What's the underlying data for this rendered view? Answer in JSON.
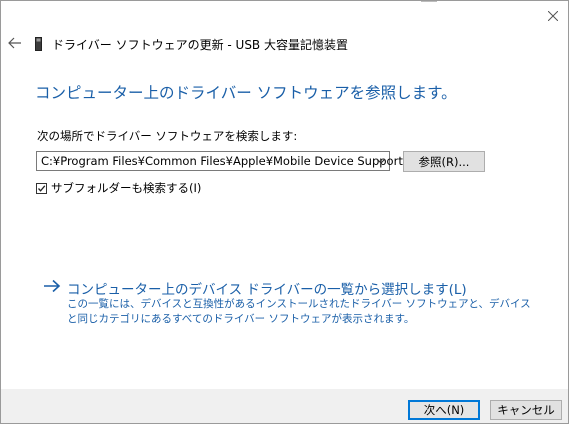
{
  "window": {
    "title": "ドライバー ソフトウェアの更新 - USB 大容量記憶装置",
    "close_icon": "close-icon",
    "back_icon": "back-arrow-icon"
  },
  "main": {
    "heading": "コンピューター上のドライバー ソフトウェアを参照します。",
    "search_label": "次の場所でドライバー ソフトウェアを検索します:",
    "path_value": "C:¥Program Files¥Common Files¥Apple¥Mobile Device Support",
    "browse_label": "参照(R)...",
    "include_subfolders_label": "サブフォルダーも検索する(I)",
    "include_subfolders_checked": true
  },
  "option": {
    "title": "コンピューター上のデバイス ドライバーの一覧から選択します(L)",
    "description": "この一覧には、デバイスと互換性があるインストールされたドライバー ソフトウェアと、デバイスと同じカテゴリにあるすべてのドライバー ソフトウェアが表示されます。"
  },
  "footer": {
    "next_label": "次へ(N)",
    "cancel_label": "キャンセル"
  },
  "colors": {
    "link_blue": "#1a5fa8",
    "focus_blue": "#0078d7"
  }
}
